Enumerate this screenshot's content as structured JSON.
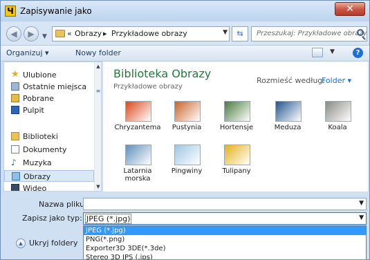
{
  "window": {
    "title": "Zapisywanie jako",
    "close_glyph": "✕"
  },
  "address": {
    "path_prefix": "«",
    "crumbs": [
      "Obrazy",
      "Przykładowe obrazy"
    ],
    "separator": "▸"
  },
  "search": {
    "placeholder": "Przeszukaj: Przykładowe obrazy"
  },
  "toolbar": {
    "organize": "Organizuj ▾",
    "new_folder": "Nowy folder",
    "help": "?"
  },
  "sidebar": {
    "items": [
      {
        "label": "Ulubione",
        "icon": "star-icon"
      },
      {
        "label": "Ostatnie miejsca",
        "icon": "recent-places-icon"
      },
      {
        "label": "Pobrane",
        "icon": "downloads-folder-icon"
      },
      {
        "label": "Pulpit",
        "icon": "desktop-icon"
      },
      {
        "label": "Biblioteki",
        "icon": "libraries-icon"
      },
      {
        "label": "Dokumenty",
        "icon": "documents-icon"
      },
      {
        "label": "Muzyka",
        "icon": "music-icon"
      },
      {
        "label": "Obrazy",
        "icon": "pictures-icon"
      },
      {
        "label": "Wideo",
        "icon": "video-icon"
      }
    ],
    "selected": "Obrazy"
  },
  "library": {
    "title": "Biblioteka Obrazy",
    "subtitle": "Przykładowe obrazy",
    "arrange_label": "Rozmieść według:",
    "arrange_value": "Folder ▾"
  },
  "files": [
    {
      "label": "Chryzantema",
      "icon": "chrysanthemum-thumbnail",
      "color": "#d9481b"
    },
    {
      "label": "Pustynia",
      "icon": "desert-thumbnail",
      "color": "#c8642a"
    },
    {
      "label": "Hortensje",
      "icon": "hydrangeas-thumbnail",
      "color": "#4a7c3c"
    },
    {
      "label": "Meduza",
      "icon": "jellyfish-thumbnail",
      "color": "#22558f"
    },
    {
      "label": "Koala",
      "icon": "koala-thumbnail",
      "color": "#8a8a84"
    },
    {
      "label": "Latarnia morska",
      "icon": "lighthouse-thumbnail",
      "color": "#5f8fb8"
    },
    {
      "label": "Pingwiny",
      "icon": "penguins-thumbnail",
      "color": "#9fc6e3"
    },
    {
      "label": "Tulipany",
      "icon": "tulips-thumbnail",
      "color": "#e3b21c"
    }
  ],
  "form": {
    "filename_label": "Nazwa pliku:",
    "filename_value": "",
    "filetype_label": "Zapisz jako typ:",
    "filetype_value": "JPEG (*.jpg)",
    "filetype_options": [
      "JPEG (*.jpg)",
      "PNG(*.png)",
      "Exporter3D 3DE(*.3de)",
      "Stereo 3D JPS (.jps)"
    ]
  },
  "hide_folders": {
    "label": "Ukryj foldery"
  },
  "colors": {
    "accent": "#3399ff",
    "library_title": "#1f7a3b",
    "link": "#1d6fd2"
  }
}
